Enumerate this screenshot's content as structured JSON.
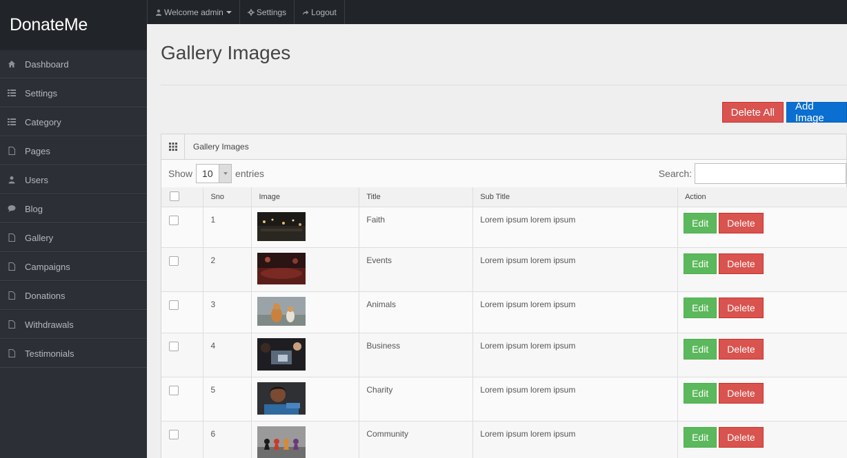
{
  "brand": {
    "name": "DonateMe"
  },
  "topbar": {
    "welcome": "Welcome admin",
    "settings": "Settings",
    "logout": "Logout"
  },
  "sidebar": {
    "items": [
      {
        "label": "Dashboard",
        "icon": "home-icon"
      },
      {
        "label": "Settings",
        "icon": "list-icon"
      },
      {
        "label": "Category",
        "icon": "list-icon"
      },
      {
        "label": "Pages",
        "icon": "page-icon"
      },
      {
        "label": "Users",
        "icon": "user-icon"
      },
      {
        "label": "Blog",
        "icon": "comment-icon"
      },
      {
        "label": "Gallery",
        "icon": "page-icon"
      },
      {
        "label": "Campaigns",
        "icon": "page-icon"
      },
      {
        "label": "Donations",
        "icon": "page-icon"
      },
      {
        "label": "Withdrawals",
        "icon": "page-icon"
      },
      {
        "label": "Testimonials",
        "icon": "page-icon"
      }
    ]
  },
  "main": {
    "title": "Gallery Images",
    "delete_all": "Delete All",
    "add_image": "Add Image",
    "widget_title": "Gallery Images",
    "show_label": "Show",
    "page_length": "10",
    "entries_label": "entries",
    "search_label": "Search:",
    "search_value": "",
    "columns": [
      "Sno",
      "Image",
      "Title",
      "Sub Title",
      "Action"
    ],
    "edit_label": "Edit",
    "delete_label": "Delete",
    "rows": [
      {
        "sno": "1",
        "title": "Faith",
        "subtitle": "Lorem ipsum lorem ipsum"
      },
      {
        "sno": "2",
        "title": "Events",
        "subtitle": "Lorem ipsum lorem ipsum"
      },
      {
        "sno": "3",
        "title": "Animals",
        "subtitle": "Lorem ipsum lorem ipsum"
      },
      {
        "sno": "4",
        "title": "Business",
        "subtitle": "Lorem ipsum lorem ipsum"
      },
      {
        "sno": "5",
        "title": "Charity",
        "subtitle": "Lorem ipsum lorem ipsum"
      },
      {
        "sno": "6",
        "title": "Community",
        "subtitle": "Lorem ipsum lorem ipsum"
      }
    ]
  },
  "colors": {
    "sidebar_bg": "#2c3036",
    "topbar_bg": "#212428",
    "danger": "#d9534f",
    "success": "#5cb85c",
    "primary": "#0a6fd0"
  }
}
